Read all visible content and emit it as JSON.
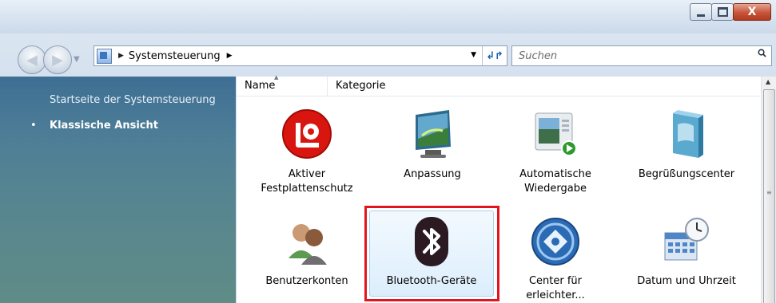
{
  "window": {
    "controls": {
      "minimize": "",
      "maximize": "",
      "close": "X"
    }
  },
  "navigation": {
    "address": {
      "location": "Systemsteuerung"
    },
    "search": {
      "placeholder": "Suchen"
    }
  },
  "sidebar": {
    "items": [
      {
        "label": "Startseite der Systemsteuerung",
        "active": false
      },
      {
        "label": "Klassische Ansicht",
        "active": true,
        "bullet": "•"
      }
    ]
  },
  "columns": {
    "name": "Name",
    "category": "Kategorie"
  },
  "items": [
    {
      "id": "festplattenschutz",
      "label_lines": [
        "Aktiver",
        "Festplattenschutz"
      ],
      "icon": "hdd-protection-icon"
    },
    {
      "id": "anpassung",
      "label_lines": [
        "Anpassung"
      ],
      "icon": "personalization-icon"
    },
    {
      "id": "wiedergabe",
      "label_lines": [
        "Automatische",
        "Wiedergabe"
      ],
      "icon": "autoplay-icon"
    },
    {
      "id": "begruessung",
      "label_lines": [
        "Begrüßungscenter"
      ],
      "icon": "welcome-center-icon"
    },
    {
      "id": "benutzer",
      "label_lines": [
        "Benutzerkonten"
      ],
      "icon": "user-accounts-icon"
    },
    {
      "id": "bluetooth",
      "label_lines": [
        "Bluetooth-Geräte"
      ],
      "icon": "bluetooth-icon",
      "selected": true,
      "highlight_color": "#e2151d"
    },
    {
      "id": "erleichtert",
      "label_lines": [
        "Center für",
        "erleichter..."
      ],
      "icon": "ease-of-access-icon"
    },
    {
      "id": "datum",
      "label_lines": [
        "Datum und Uhrzeit"
      ],
      "icon": "date-time-icon"
    }
  ],
  "colors": {
    "sidebar_top": "#3e6f94",
    "sidebar_bottom": "#5f8c86",
    "highlight": "#e2151d",
    "selection": "#dceefc"
  }
}
